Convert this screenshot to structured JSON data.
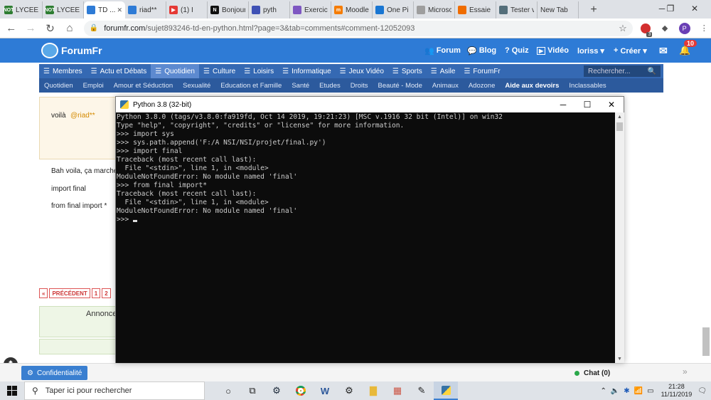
{
  "browser": {
    "tabs": [
      {
        "label": "LYCEE (",
        "favicon_color": "#2e7d32",
        "favicon_text": "NOT"
      },
      {
        "label": "LYCEE (",
        "favicon_color": "#2e7d32",
        "favicon_text": "NOT"
      },
      {
        "label": "TD ...",
        "favicon_color": "#2e7bd6",
        "favicon_text": "",
        "active": true
      },
      {
        "label": "riad**",
        "favicon_color": "#2e7bd6",
        "favicon_text": ""
      },
      {
        "label": "(1) I",
        "favicon_color": "#e53935",
        "favicon_text": "▶"
      },
      {
        "label": "Bonjour",
        "favicon_color": "#111111",
        "favicon_text": "N"
      },
      {
        "label": "pyth",
        "favicon_color": "#3f51b5",
        "favicon_text": ""
      },
      {
        "label": "Exercic",
        "favicon_color": "#7e57c2",
        "favicon_text": ""
      },
      {
        "label": "Moodle",
        "favicon_color": "#f57c00",
        "favicon_text": "m"
      },
      {
        "label": "One Pi",
        "favicon_color": "#1976d2",
        "favicon_text": ""
      },
      {
        "label": "Microsc",
        "favicon_color": "#9e9e9e",
        "favicon_text": ""
      },
      {
        "label": "Essaie d",
        "favicon_color": "#ef6c00",
        "favicon_text": ""
      },
      {
        "label": "Tester v",
        "favicon_color": "#546e7a",
        "favicon_text": ""
      },
      {
        "label": "New Tab",
        "favicon_color": "",
        "favicon_text": ""
      }
    ],
    "url_host": "forumfr.com",
    "url_path": "/sujet893246-td-en-python.html?page=3&tab=comments#comment-12052093",
    "profile_initial": "P",
    "ext_badge": "3"
  },
  "site": {
    "logo_text": "ForumFr",
    "top_nav": [
      {
        "icon": "👥",
        "label": "Forum"
      },
      {
        "icon": "💬",
        "label": "Blog"
      },
      {
        "icon": "?",
        "label": "Quiz"
      },
      {
        "icon": "▶",
        "label": "Vidéo"
      },
      {
        "icon": "",
        "label": "loriss ▾"
      },
      {
        "icon": "+",
        "label": "Créer ▾"
      }
    ],
    "notif_count": "10",
    "categories": [
      "Membres",
      "Actu et Débats",
      "Quotidien",
      "Culture",
      "Loisirs",
      "Informatique",
      "Jeux Vidéo",
      "Sports",
      "Asile",
      "ForumFr"
    ],
    "search_placeholder": "Rechercher...",
    "subcategories": [
      "Quotidien",
      "Emploi",
      "Amour et Séduction",
      "Sexualité",
      "Education et Famille",
      "Santé",
      "Etudes",
      "Droits",
      "Beauté - Mode",
      "Animaux",
      "Adozone",
      "Aide aux devoirs",
      "Inclassables"
    ],
    "post": {
      "voila": "voilà",
      "mention": "@riad**",
      "line1": "Bah voila, ça marche",
      "line2": "import final",
      "line3": "from final import *"
    },
    "pager": {
      "prev": "«",
      "prev_label": "PRÉCÉDENT",
      "p1": "1",
      "p2": "2"
    },
    "annonce": "Annonce",
    "privacy": "Confidentialité",
    "chat": "Chat (0)"
  },
  "python_window": {
    "title": "Python 3.8 (32-bit)",
    "lines": [
      "Python 3.8.0 (tags/v3.8.0:fa919fd, Oct 14 2019, 19:21:23) [MSC v.1916 32 bit (Intel)] on win32",
      "Type \"help\", \"copyright\", \"credits\" or \"license\" for more information.",
      ">>> import sys",
      ">>> sys.path.append('F:/A NSI/NSI/projet/final.py')",
      ">>> import final",
      "Traceback (most recent call last):",
      "  File \"<stdin>\", line 1, in <module>",
      "ModuleNotFoundError: No module named 'final'",
      ">>> from final import*",
      "Traceback (most recent call last):",
      "  File \"<stdin>\", line 1, in <module>",
      "ModuleNotFoundError: No module named 'final'"
    ],
    "prompt": ">>> "
  },
  "taskbar": {
    "search_placeholder": "Taper ici pour rechercher",
    "time": "21:28",
    "date": "11/11/2019"
  }
}
